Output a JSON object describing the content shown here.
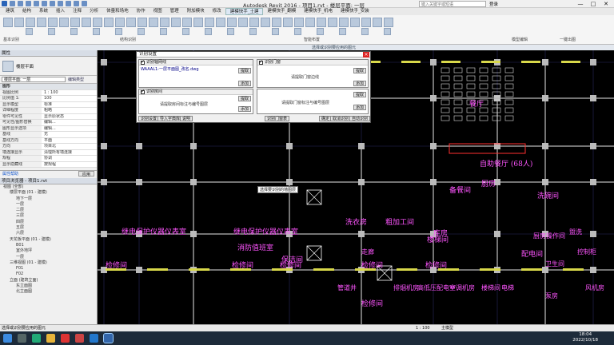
{
  "window": {
    "title": "Autodesk Revit 2016 -  项目1.rvt - 楼层平面: 一层",
    "search_placeholder": "键入关键字或短语",
    "signin": "登录",
    "min": "—",
    "max": "□",
    "close": "✕"
  },
  "menu": [
    "建筑",
    "结构",
    "系统",
    "插入",
    "注释",
    "分析",
    "体量和场地",
    "协作",
    "视图",
    "管理",
    "附加模块",
    "修改",
    "建模快手_土建",
    "建模快手_翻模",
    "建模快手_机电",
    "建模快手_安装"
  ],
  "menu_active_index": 12,
  "ribbon_panels": [
    "基本识别",
    "结构识别",
    "智能布置",
    "模型编辑",
    "一键出图"
  ],
  "context_bar": "选择或识别要应用的图元",
  "properties": {
    "header": "属性",
    "type": "楼层平面",
    "floor_selector": "楼层平面: 一层",
    "edit_type": "编辑类型",
    "section": "图形",
    "rows": [
      {
        "k": "视图比例",
        "v": "1 : 100"
      },
      {
        "k": "比例值 1:",
        "v": "100"
      },
      {
        "k": "显示模型",
        "v": "标准"
      },
      {
        "k": "详细程度",
        "v": "粗略"
      },
      {
        "k": "零件可见性",
        "v": "显示原状态"
      },
      {
        "k": "可见性/图形替换",
        "v": "编辑..."
      },
      {
        "k": "图形显示选项",
        "v": "编辑..."
      },
      {
        "k": "基线",
        "v": "无"
      },
      {
        "k": "基线方向",
        "v": "平面"
      },
      {
        "k": "方向",
        "v": "项目北"
      },
      {
        "k": "墙连接显示",
        "v": "清理所有墙连接"
      },
      {
        "k": "规程",
        "v": "协调"
      },
      {
        "k": "显示隐藏线",
        "v": "按规程"
      }
    ],
    "help": "属性帮助",
    "apply": "应用"
  },
  "browser": {
    "header": "项目浏览器 - 项目1.rvt",
    "items": [
      "视图 (全部)",
      "楼层平面 (01 - 建模)",
      "地下一层",
      "一层",
      "二层",
      "三层",
      "四层",
      "五层",
      "六层",
      "天花板平面 (01 - 建模)",
      "B01",
      "室外地坪",
      "一层",
      "三维视图 (01 - 建模)",
      "F01",
      "F02",
      "立面 (建筑立面)",
      "东立面图",
      "北立面图"
    ]
  },
  "dialog": {
    "title": "识别设置",
    "group1": {
      "label": "识别轴网线",
      "file": "WAAAL1-一层平面图_改名.dwg",
      "btn_pick": "提取",
      "btn_add": "添加"
    },
    "group2": {
      "label": "识别门窗",
      "hint": "请提取门窗边线",
      "btn_pick": "提取",
      "btn_add": "添加"
    },
    "group3": {
      "label": "识别房间",
      "hint": "请提取房间标注与编号图层",
      "btn_pick": "提取",
      "btn_add": "添加"
    },
    "group4": {
      "hint": "请提取门窗标注与编号图层",
      "btn_pick": "提取",
      "btn_add": "添加"
    },
    "bottom_left": [
      "识别设置",
      "导入字典库",
      "说明"
    ],
    "bottom_mid": "识别门窗表",
    "bottom_right": [
      "确定",
      "取消识别",
      "自动识别"
    ]
  },
  "cursor_tooltip": "选择要识别的墙图层",
  "drawing_labels": [
    "检修间",
    "检修间",
    "检修间",
    "检修间",
    "检修间",
    "检修间",
    "餐厅",
    "自助餐厅 (68人)",
    "洗碗间",
    "备餐间",
    "楼梯间",
    "厨房",
    "粗加工间",
    "库房",
    "继电保护仪器仪表室",
    "继电保护仪器仪表室",
    "洗衣房",
    "保洁间",
    "消防值班室",
    "配电间",
    "控制柜",
    "风机房",
    "卫生间",
    "走廊",
    "泵房",
    "楼梯间",
    "管道井",
    "排烟机房",
    "高低压配电室",
    "空调机房",
    "电梯",
    "厨房操作间",
    "盥洗"
  ],
  "status": {
    "left": "选择或识别要应用的图元",
    "scale": "1 : 100",
    "model": "主模型"
  },
  "taskbar": {
    "time": "18:04",
    "date": "2022/10/18"
  }
}
